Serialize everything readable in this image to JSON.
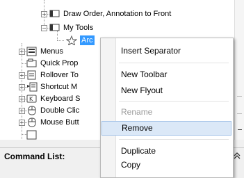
{
  "tree": {
    "items": [
      {
        "label": "Draw Order, Annotation to Front",
        "icon": "toolbar-icon"
      },
      {
        "label": "My Tools",
        "icon": "toolbar-icon"
      },
      {
        "label": "Arc",
        "icon": "star-icon",
        "selected": true
      },
      {
        "label": "Menus",
        "icon": "menu-icon"
      },
      {
        "label": "Quick Prop",
        "icon": "quick-properties-icon"
      },
      {
        "label": "Rollover To",
        "icon": "rollover-tooltip-icon"
      },
      {
        "label": "Shortcut M",
        "icon": "shortcut-menu-icon"
      },
      {
        "label": "Keyboard S",
        "icon": "keyboard-shortcut-icon"
      },
      {
        "label": "Double Clic",
        "icon": "double-click-icon"
      },
      {
        "label": "Mouse Butt",
        "icon": "mouse-button-icon"
      }
    ]
  },
  "context_menu": {
    "items": [
      {
        "label": "Insert Separator",
        "enabled": true
      },
      {
        "label": "New Toolbar",
        "enabled": true
      },
      {
        "label": "New Flyout",
        "enabled": true
      },
      {
        "label": "Rename",
        "enabled": false
      },
      {
        "label": "Remove",
        "enabled": true,
        "highlighted": true
      },
      {
        "label": "Duplicate",
        "enabled": true
      },
      {
        "label": "Copy",
        "enabled": true
      }
    ]
  },
  "command_list": {
    "title": "Command List:",
    "collapse_icon": "double-chevron-up-icon"
  },
  "colors": {
    "selection": "#3399ff",
    "menu_hover": "#dbe8f7"
  }
}
